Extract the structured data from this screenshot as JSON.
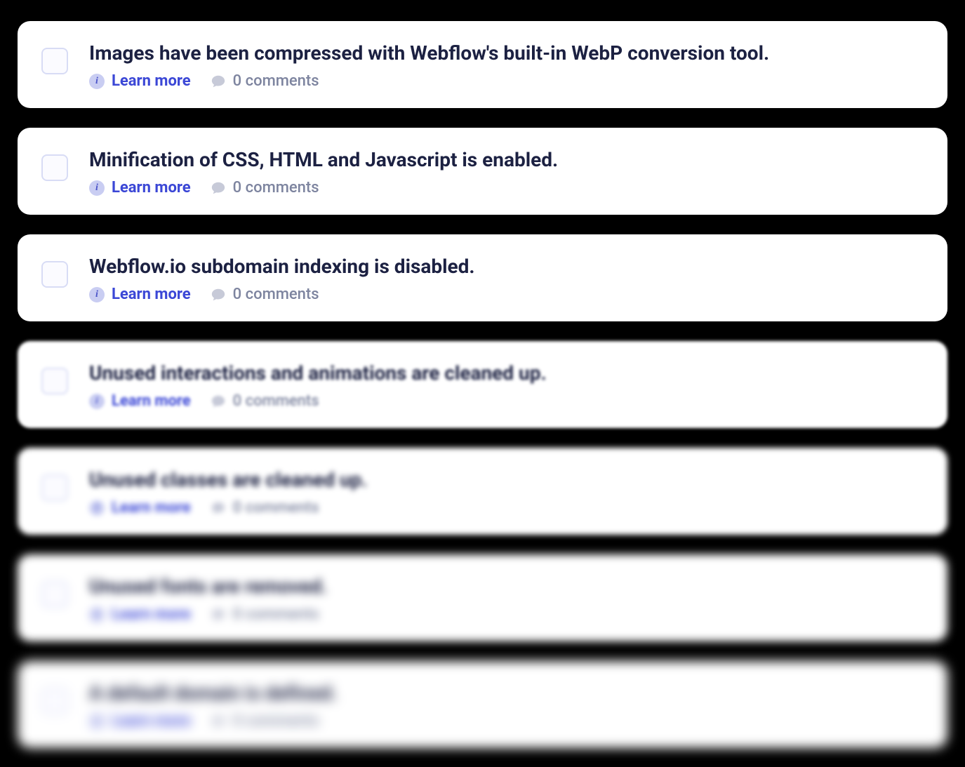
{
  "common": {
    "learn_more": "Learn more",
    "comments_prefix": "0 comments"
  },
  "items": [
    {
      "title": "Images have been compressed with Webflow's built-in WebP conversion tool.",
      "comments": "0 comments",
      "blur": 0
    },
    {
      "title": "Minification of CSS, HTML and Javascript is enabled.",
      "comments": "0 comments",
      "blur": 0
    },
    {
      "title": "Webflow.io subdomain indexing is disabled.",
      "comments": "0 comments",
      "blur": 0
    },
    {
      "title": "Unused interactions and animations are cleaned up.",
      "comments": "0 comments",
      "blur": 1
    },
    {
      "title": "Unused classes are cleaned up.",
      "comments": "0 comments",
      "blur": 2
    },
    {
      "title": "Unused fonts are removed.",
      "comments": "0 comments",
      "blur": 3
    },
    {
      "title": "A default domain is defined.",
      "comments": "0 comments",
      "blur": 4
    }
  ]
}
